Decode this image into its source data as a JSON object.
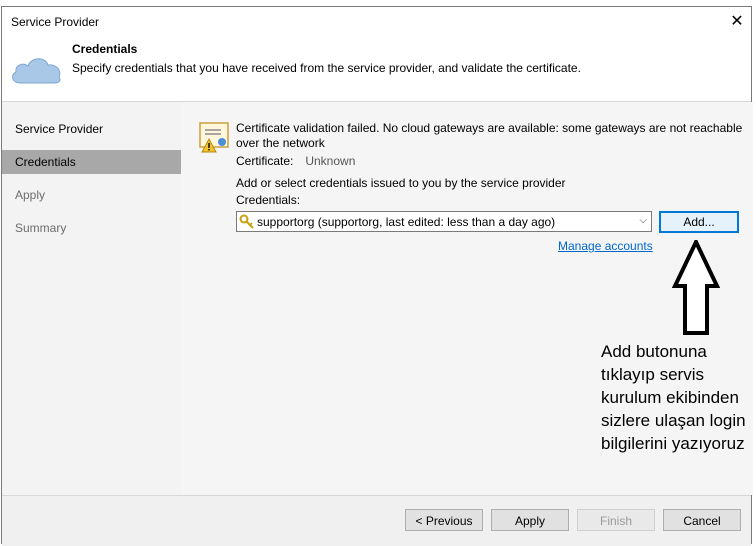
{
  "window": {
    "title": "Service Provider",
    "close_glyph": "✕"
  },
  "header": {
    "title": "Credentials",
    "description": "Specify credentials that you have received from the service provider, and validate the certificate."
  },
  "sidebar": {
    "items": [
      {
        "label": "Service Provider",
        "state": "normal"
      },
      {
        "label": "Credentials",
        "state": "active"
      },
      {
        "label": "Apply",
        "state": "disabled"
      },
      {
        "label": "Summary",
        "state": "disabled"
      }
    ]
  },
  "main": {
    "warning": "Certificate validation failed. No cloud gateways are available: some gateways are not reachable over the network",
    "certificate_label": "Certificate:",
    "certificate_value": "Unknown",
    "instruction": "Add or select credentials issued to you by the service provider",
    "credentials_label": "Credentials:",
    "credentials_selected": "supportorg (supportorg, last edited: less than a day ago)",
    "add_button": "Add...",
    "manage_link": "Manage accounts"
  },
  "annotation": {
    "text": "Add butonuna\ntıklayıp servis\nkurulum ekibinden\nsizlere ulaşan login\nbilgilerini yazıyoruz"
  },
  "footer": {
    "previous": "< Previous",
    "apply": "Apply",
    "finish": "Finish",
    "cancel": "Cancel"
  },
  "colors": {
    "accent": "#0078d7",
    "link": "#0066cc",
    "sidebar_active": "#a8a8a8",
    "cloud": "#a9c8e8"
  },
  "icons": [
    "cloud-icon",
    "certificate-warning-icon",
    "key-icon",
    "chevron-down-icon",
    "close-icon",
    "up-arrow-annotation"
  ]
}
